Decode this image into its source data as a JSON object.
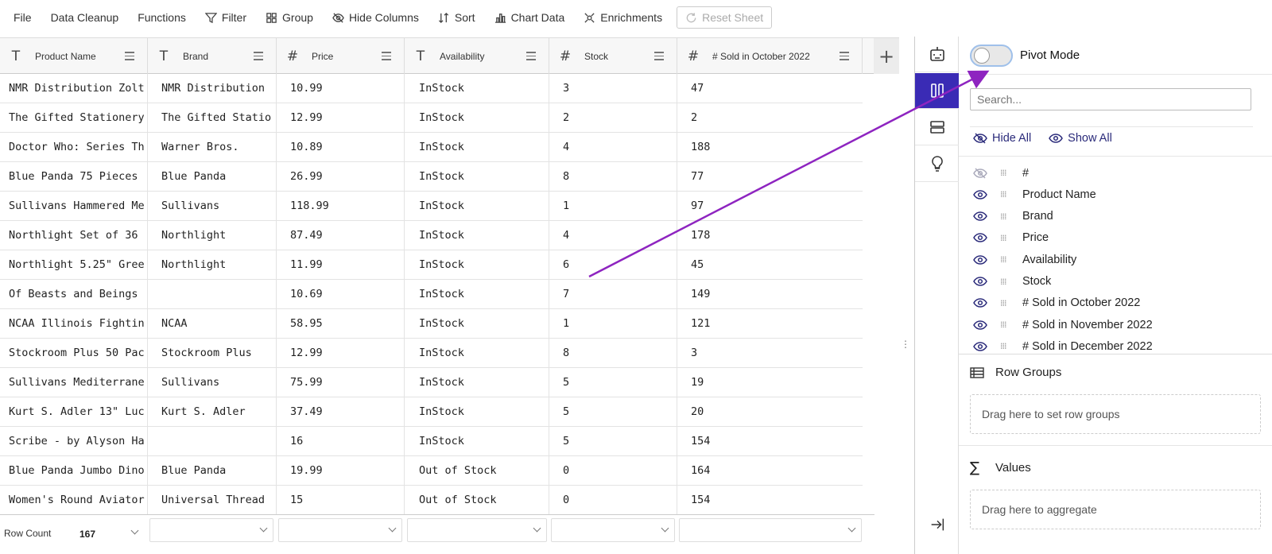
{
  "toolbar": {
    "file": "File",
    "data_cleanup": "Data Cleanup",
    "functions": "Functions",
    "filter": "Filter",
    "group": "Group",
    "hide_columns": "Hide Columns",
    "sort": "Sort",
    "chart_data": "Chart Data",
    "enrichments": "Enrichments",
    "reset_sheet": "Reset Sheet"
  },
  "grid": {
    "columns": [
      {
        "type": "T",
        "label": "Product Name"
      },
      {
        "type": "T",
        "label": "Brand"
      },
      {
        "type": "#",
        "label": "Price"
      },
      {
        "type": "T",
        "label": "Availability"
      },
      {
        "type": "#",
        "label": "Stock"
      },
      {
        "type": "#",
        "label": "# Sold in October 2022"
      }
    ],
    "rows": [
      [
        "NMR Distribution Zolt",
        "NMR Distribution",
        "10.99",
        "InStock",
        "3",
        "47"
      ],
      [
        "The Gifted Stationery",
        "The Gifted Statio",
        "12.99",
        "InStock",
        "2",
        "2"
      ],
      [
        "Doctor Who: Series Th",
        "Warner Bros.",
        "10.89",
        "InStock",
        "4",
        "188"
      ],
      [
        "Blue Panda 75 Pieces ",
        "Blue Panda",
        "26.99",
        "InStock",
        "8",
        "77"
      ],
      [
        "Sullivans Hammered Me",
        "Sullivans",
        "118.99",
        "InStock",
        "1",
        "97"
      ],
      [
        "Northlight Set of 36 ",
        "Northlight",
        "87.49",
        "InStock",
        "4",
        "178"
      ],
      [
        "Northlight 5.25\" Gree",
        "Northlight",
        "11.99",
        "InStock",
        "6",
        "45"
      ],
      [
        "Of Beasts and Beings ",
        "",
        "10.69",
        "InStock",
        "7",
        "149"
      ],
      [
        "NCAA Illinois Fightin",
        "NCAA",
        "58.95",
        "InStock",
        "1",
        "121"
      ],
      [
        "Stockroom Plus 50 Pac",
        "Stockroom Plus",
        "12.99",
        "InStock",
        "8",
        "3"
      ],
      [
        "Sullivans Mediterrane",
        "Sullivans",
        "75.99",
        "InStock",
        "5",
        "19"
      ],
      [
        "Kurt S. Adler 13\" Luc",
        "Kurt S. Adler",
        "37.49",
        "InStock",
        "5",
        "20"
      ],
      [
        "Scribe - by Alyson Ha",
        "",
        "16",
        "InStock",
        "5",
        "154"
      ],
      [
        "Blue Panda Jumbo Dino",
        "Blue Panda",
        "19.99",
        "Out of Stock",
        "0",
        "164"
      ],
      [
        "Women's Round Aviator",
        "Universal Thread",
        "15",
        "Out of Stock",
        "0",
        "154"
      ]
    ],
    "footer": {
      "row_count_label": "Row Count",
      "row_count_value": "167"
    }
  },
  "panel": {
    "pivot_mode": "Pivot Mode",
    "pivot_enabled": false,
    "search_placeholder": "Search...",
    "hide_all": "Hide All",
    "show_all": "Show All",
    "column_list": [
      {
        "label": "#",
        "visible": false
      },
      {
        "label": "Product Name",
        "visible": true
      },
      {
        "label": "Brand",
        "visible": true
      },
      {
        "label": "Price",
        "visible": true
      },
      {
        "label": "Availability",
        "visible": true
      },
      {
        "label": "Stock",
        "visible": true
      },
      {
        "label": "# Sold in October 2022",
        "visible": true
      },
      {
        "label": "# Sold in November 2022",
        "visible": true
      },
      {
        "label": "# Sold in December 2022",
        "visible": true
      }
    ],
    "row_groups": {
      "title": "Row Groups",
      "drop_text": "Drag here to set row groups"
    },
    "values": {
      "title": "Values",
      "drop_text": "Drag here to aggregate"
    }
  },
  "colors": {
    "accent": "#3a2bb5",
    "annotation_arrow": "#8e24c0",
    "link": "#2a2a7a"
  }
}
